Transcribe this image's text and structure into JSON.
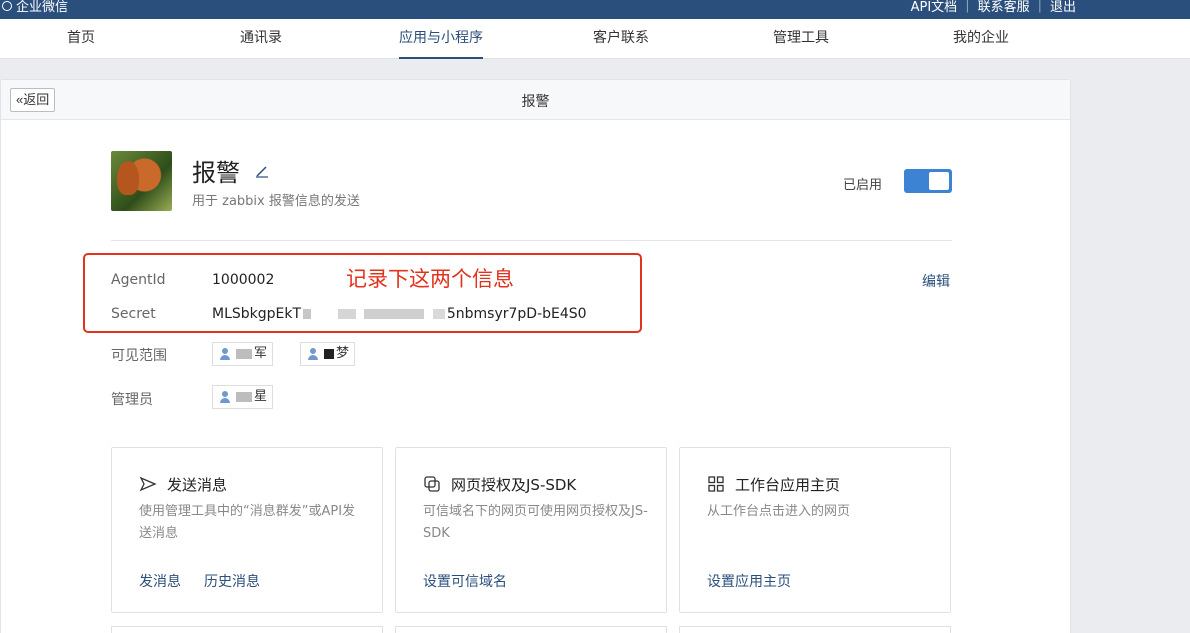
{
  "topbar": {
    "brand": "企业微信",
    "links": [
      "API文档",
      "联系客服",
      "退出"
    ]
  },
  "nav": {
    "items": [
      "首页",
      "通讯录",
      "应用与小程序",
      "客户联系",
      "管理工具",
      "我的企业"
    ],
    "active": "应用与小程序"
  },
  "panel": {
    "back_label": "返回",
    "title": "报警"
  },
  "app": {
    "name": "报警",
    "description": "用于 zabbix 报警信息的发送",
    "status_label": "已启用",
    "enabled": true
  },
  "info": {
    "agentid_label": "AgentId",
    "agentid_value": "1000002",
    "secret_label": "Secret",
    "secret_prefix": "MLSbkgpEkT",
    "secret_suffix": "5nbmsyr7pD-bE4S0",
    "annotation": "记录下这两个信息",
    "edit_label": "编辑",
    "visibility_label": "可见范围",
    "visibility_users": [
      "军",
      "梦"
    ],
    "admin_label": "管理员",
    "admin_users": [
      "星"
    ]
  },
  "cards": [
    {
      "icon": "send-icon",
      "title": "发送消息",
      "description": "使用管理工具中的“消息群发”或API发送消息",
      "links": [
        "发消息",
        "历史消息"
      ]
    },
    {
      "icon": "web-auth-icon",
      "title": "网页授权及JS-SDK",
      "description": "可信域名下的网页可使用网页授权及JS-SDK",
      "links": [
        "设置可信域名"
      ]
    },
    {
      "icon": "grid-icon",
      "title": "工作台应用主页",
      "description": "从工作台点击进入的网页",
      "links": [
        "设置应用主页"
      ]
    }
  ],
  "colors": {
    "brand_blue": "#2b4f7c",
    "toggle_blue": "#3d83d4",
    "annotation_red": "#e2331f"
  }
}
